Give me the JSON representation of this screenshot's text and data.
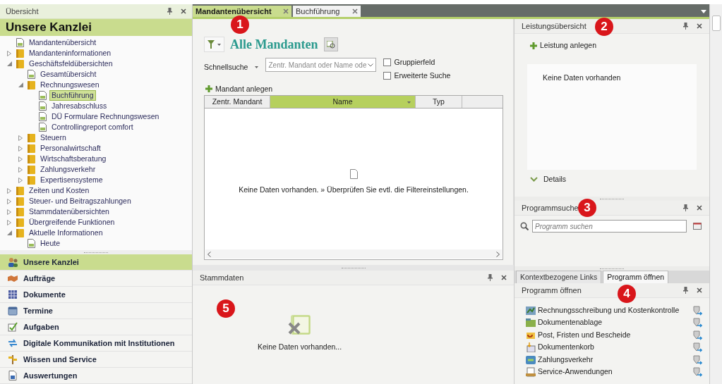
{
  "overview_panel": {
    "title": "Übersicht",
    "heading": "Unsere Kanzlei",
    "tree": [
      {
        "label": "Mandantenübersicht",
        "kind": "doc",
        "selected": false
      },
      {
        "label": "Mandanteninformationen",
        "kind": "folder",
        "expanded": false,
        "selected": false
      },
      {
        "label": "Geschäftsfeldübersichten",
        "kind": "folder",
        "expanded": true,
        "selected": false,
        "children": [
          {
            "label": "Gesamtübersicht",
            "kind": "doc",
            "selected": false
          },
          {
            "label": "Rechnungswesen",
            "kind": "folder",
            "expanded": true,
            "selected": false,
            "children": [
              {
                "label": "Buchführung",
                "kind": "doc",
                "selected": true
              },
              {
                "label": "Jahresabschluss",
                "kind": "doc",
                "selected": false
              },
              {
                "label": "DÜ Formulare Rechnungswesen",
                "kind": "doc",
                "selected": false
              },
              {
                "label": "Controllingreport comfort",
                "kind": "doc",
                "selected": false
              }
            ]
          },
          {
            "label": "Steuern",
            "kind": "folder",
            "expanded": false,
            "selected": false
          },
          {
            "label": "Personalwirtschaft",
            "kind": "folder",
            "expanded": false,
            "selected": false
          },
          {
            "label": "Wirtschaftsberatung",
            "kind": "folder",
            "expanded": false,
            "selected": false
          },
          {
            "label": "Zahlungsverkehr",
            "kind": "folder",
            "expanded": false,
            "selected": false
          },
          {
            "label": "Expertisensysteme",
            "kind": "folder",
            "expanded": false,
            "selected": false
          }
        ]
      },
      {
        "label": "Zeiten und Kosten",
        "kind": "folder",
        "expanded": false,
        "selected": false
      },
      {
        "label": "Steuer- und Beitragszahlungen",
        "kind": "folder",
        "expanded": false,
        "selected": false
      },
      {
        "label": "Stammdatenübersichten",
        "kind": "folder",
        "expanded": false,
        "selected": false
      },
      {
        "label": "Übergreifende Funktionen",
        "kind": "folder",
        "expanded": false,
        "selected": false
      },
      {
        "label": "Aktuelle Informationen",
        "kind": "folder",
        "expanded": true,
        "selected": false,
        "children": [
          {
            "label": "Heute",
            "kind": "doc",
            "selected": false
          }
        ]
      }
    ]
  },
  "navigation": [
    {
      "label": "Unsere Kanzlei",
      "selected": true
    },
    {
      "label": "Aufträge",
      "selected": false
    },
    {
      "label": "Dokumente",
      "selected": false
    },
    {
      "label": "Termine",
      "selected": false
    },
    {
      "label": "Aufgaben",
      "selected": false
    },
    {
      "label": "Digitale Kommunikation mit Institutionen",
      "selected": false
    },
    {
      "label": "Wissen und Service",
      "selected": false
    },
    {
      "label": "Auswertungen",
      "selected": false
    }
  ],
  "tabs": [
    {
      "label": "Mandantenübersicht",
      "selected": true
    },
    {
      "label": "Buchführung",
      "selected": false
    }
  ],
  "client_overview": {
    "callout": "1",
    "heading": "Alle Mandanten",
    "quick_search_label": "Schnellsuche",
    "search": {
      "placeholder": "Zentr. Mandant oder Name ode"
    },
    "options": [
      {
        "label": "Gruppierfeld",
        "checked": false
      },
      {
        "label": "Erweiterte Suche",
        "checked": false
      }
    ],
    "add_action": "Mandant anlegen",
    "table": {
      "columns": [
        {
          "label": "Zentr. Mandant",
          "sorted": false
        },
        {
          "label": "Name",
          "sorted": true
        },
        {
          "label": "Typ",
          "sorted": false
        }
      ],
      "empty_message": "Keine Daten vorhanden. » Überprüfen Sie evtl. die Filtereinstellungen."
    }
  },
  "master_data": {
    "title": "Stammdaten",
    "callout": "5",
    "empty_message": "Keine Daten vorhanden..."
  },
  "services_panel": {
    "title": "Leistungsübersicht",
    "callout": "2",
    "add_action": "Leistung anlegen",
    "empty_message": "Keine Daten vorhanden",
    "details": "Details"
  },
  "program_search": {
    "title": "Programmsuche",
    "callout": "3",
    "search": {
      "placeholder": "Programm suchen"
    }
  },
  "link_tabs": [
    {
      "label": "Kontextbezogene Links",
      "selected": false
    },
    {
      "label": "Programm öffnen",
      "selected": true
    }
  ],
  "open_program": {
    "title": "Programm öffnen",
    "callout": "4",
    "programs": [
      "Rechnungsschreibung und Kostenkontrolle",
      "Dokumentenablage",
      "Post, Fristen und Bescheide",
      "Dokumentenkorb",
      "Zahlungsverkehr",
      "Service-Anwendungen"
    ]
  }
}
